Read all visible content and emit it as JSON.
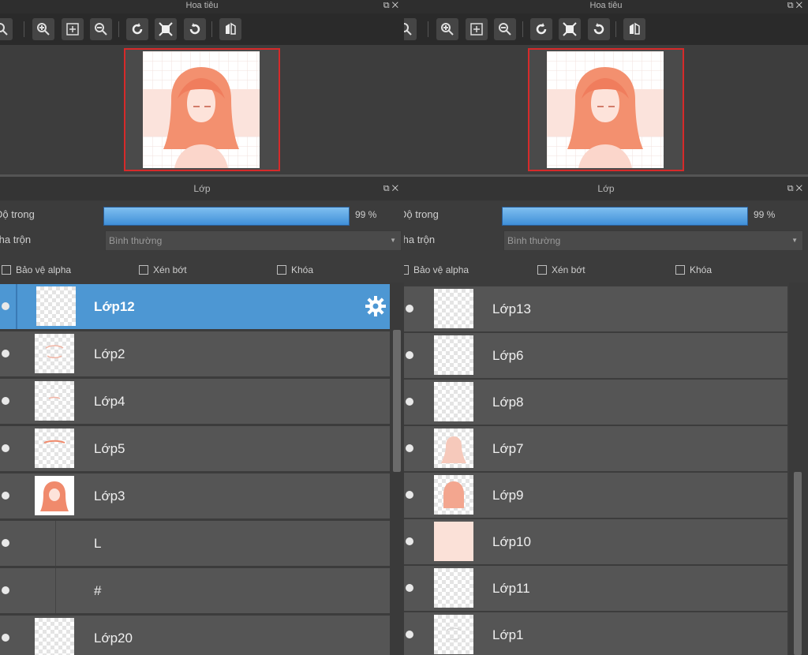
{
  "navigator": {
    "title": "Hoa tiêu"
  },
  "layers_panel": {
    "title": "Lớp",
    "opacity_label": "Độ trong",
    "opacity_value": "99 %",
    "blend_label": "Pha trộn",
    "blend_value": "Bình thường",
    "protect_alpha": "Bảo vệ alpha",
    "clipping": "Xén bớt",
    "lock": "Khóa"
  },
  "left_view": {
    "navigator_title_visible": "Hoa tiêu",
    "opacity_label_visible": "Độ trong",
    "blend_label_visible": "Pha trộn",
    "layers": [
      {
        "name": "Lớp12",
        "selected": true,
        "thumb": "empty"
      },
      {
        "name": "Lớp2",
        "selected": false,
        "thumb": "sketch"
      },
      {
        "name": "Lớp4",
        "selected": false,
        "thumb": "sketch"
      },
      {
        "name": "Lớp5",
        "selected": false,
        "thumb": "mark"
      },
      {
        "name": "Lớp3",
        "selected": false,
        "thumb": "girl"
      },
      {
        "name": "L",
        "selected": false,
        "thumb": "none"
      },
      {
        "name": "#",
        "selected": false,
        "thumb": "none"
      },
      {
        "name": "Lớp20",
        "selected": false,
        "thumb": "empty"
      }
    ]
  },
  "right_view": {
    "layers": [
      {
        "name": "Lớp13",
        "thumb": "empty"
      },
      {
        "name": "Lớp6",
        "thumb": "empty"
      },
      {
        "name": "Lớp8",
        "thumb": "empty"
      },
      {
        "name": "Lớp7",
        "thumb": "silhouette"
      },
      {
        "name": "Lớp9",
        "thumb": "block"
      },
      {
        "name": "Lớp10",
        "thumb": "flat"
      },
      {
        "name": "Lớp11",
        "thumb": "empty"
      },
      {
        "name": "Lớp1",
        "thumb": "sketch"
      }
    ]
  },
  "colors": {
    "accent": "#4d97d3",
    "frame": "#d62a2a",
    "art": "#f08a6c"
  }
}
